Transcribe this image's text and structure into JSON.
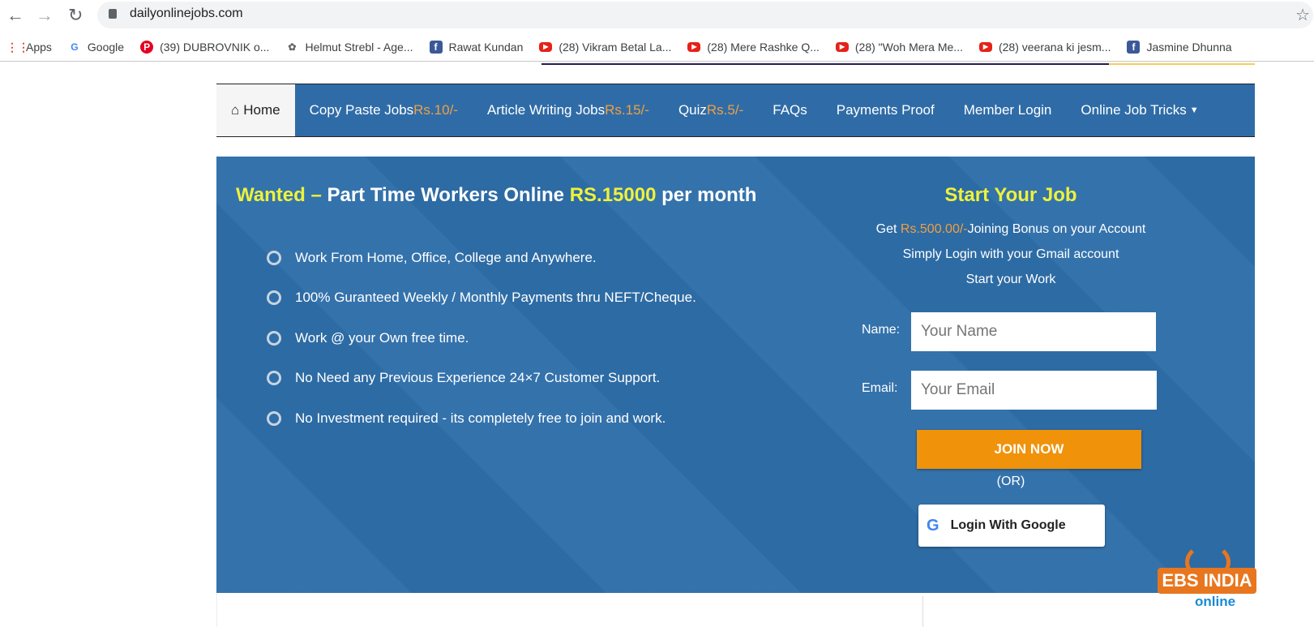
{
  "browser": {
    "url": "dailyonlinejobs.com",
    "bookmarks": [
      {
        "label": "Apps",
        "icon": "apps-grid-icon"
      },
      {
        "label": "Google",
        "icon": "google-icon"
      },
      {
        "label": "(39) DUBROVNIK o...",
        "icon": "pinterest-icon"
      },
      {
        "label": "Helmut Strebl - Age...",
        "icon": "site-icon"
      },
      {
        "label": "Rawat Kundan",
        "icon": "facebook-icon"
      },
      {
        "label": "(28) Vikram Betal La...",
        "icon": "youtube-icon"
      },
      {
        "label": "(28) Mere Rashke Q...",
        "icon": "youtube-icon"
      },
      {
        "label": "(28) \"Woh Mera Me...",
        "icon": "youtube-icon"
      },
      {
        "label": "(28) veerana ki jesm...",
        "icon": "youtube-icon"
      },
      {
        "label": "Jasmine Dhunna",
        "icon": "facebook-icon"
      }
    ]
  },
  "nav": {
    "home": "Home",
    "items": [
      {
        "label": "Copy Paste Jobs ",
        "price": "Rs.10/-"
      },
      {
        "label": "Article Writing Jobs ",
        "price": "Rs.15/-"
      },
      {
        "label": "Quiz ",
        "price": "Rs.5/-"
      },
      {
        "label": "FAQs",
        "price": ""
      },
      {
        "label": "Payments Proof",
        "price": ""
      },
      {
        "label": "Member Login",
        "price": ""
      },
      {
        "label": "Online Job Tricks",
        "price": ""
      }
    ]
  },
  "hero": {
    "headline": {
      "wanted": "Wanted –",
      "mid": " Part Time Workers Online ",
      "amount": "RS.15000",
      "end": " per month"
    },
    "bullets": [
      "Work From Home, Office, College and Anywhere.",
      "100% Guranteed Weekly / Monthly Payments thru NEFT/Cheque.",
      "Work @ your Own free time.",
      "No Need any Previous Experience 24×7 Customer Support.",
      "No Investment required - its completely free to join and work."
    ]
  },
  "signup": {
    "title": "Start Your Job",
    "line1_pre": "Get ",
    "line1_amount": "Rs.500.00/-",
    "line1_post": "Joining Bonus on your Account",
    "line2": "Simply Login with your Gmail account",
    "line3": "Start your Work",
    "name_label": "Name:",
    "name_placeholder": "Your Name",
    "email_label": "Email:",
    "email_placeholder": "Your Email",
    "join": "JOIN NOW",
    "or": "(OR)",
    "google": "Login With Google"
  },
  "logo": {
    "text": "EBS INDIA",
    "sub": "online"
  },
  "colors": {
    "brand_blue": "#2e6ea9",
    "price_orange": "#f0a040",
    "highlight_yellow": "#eef23a",
    "join_orange": "#f0920a"
  }
}
